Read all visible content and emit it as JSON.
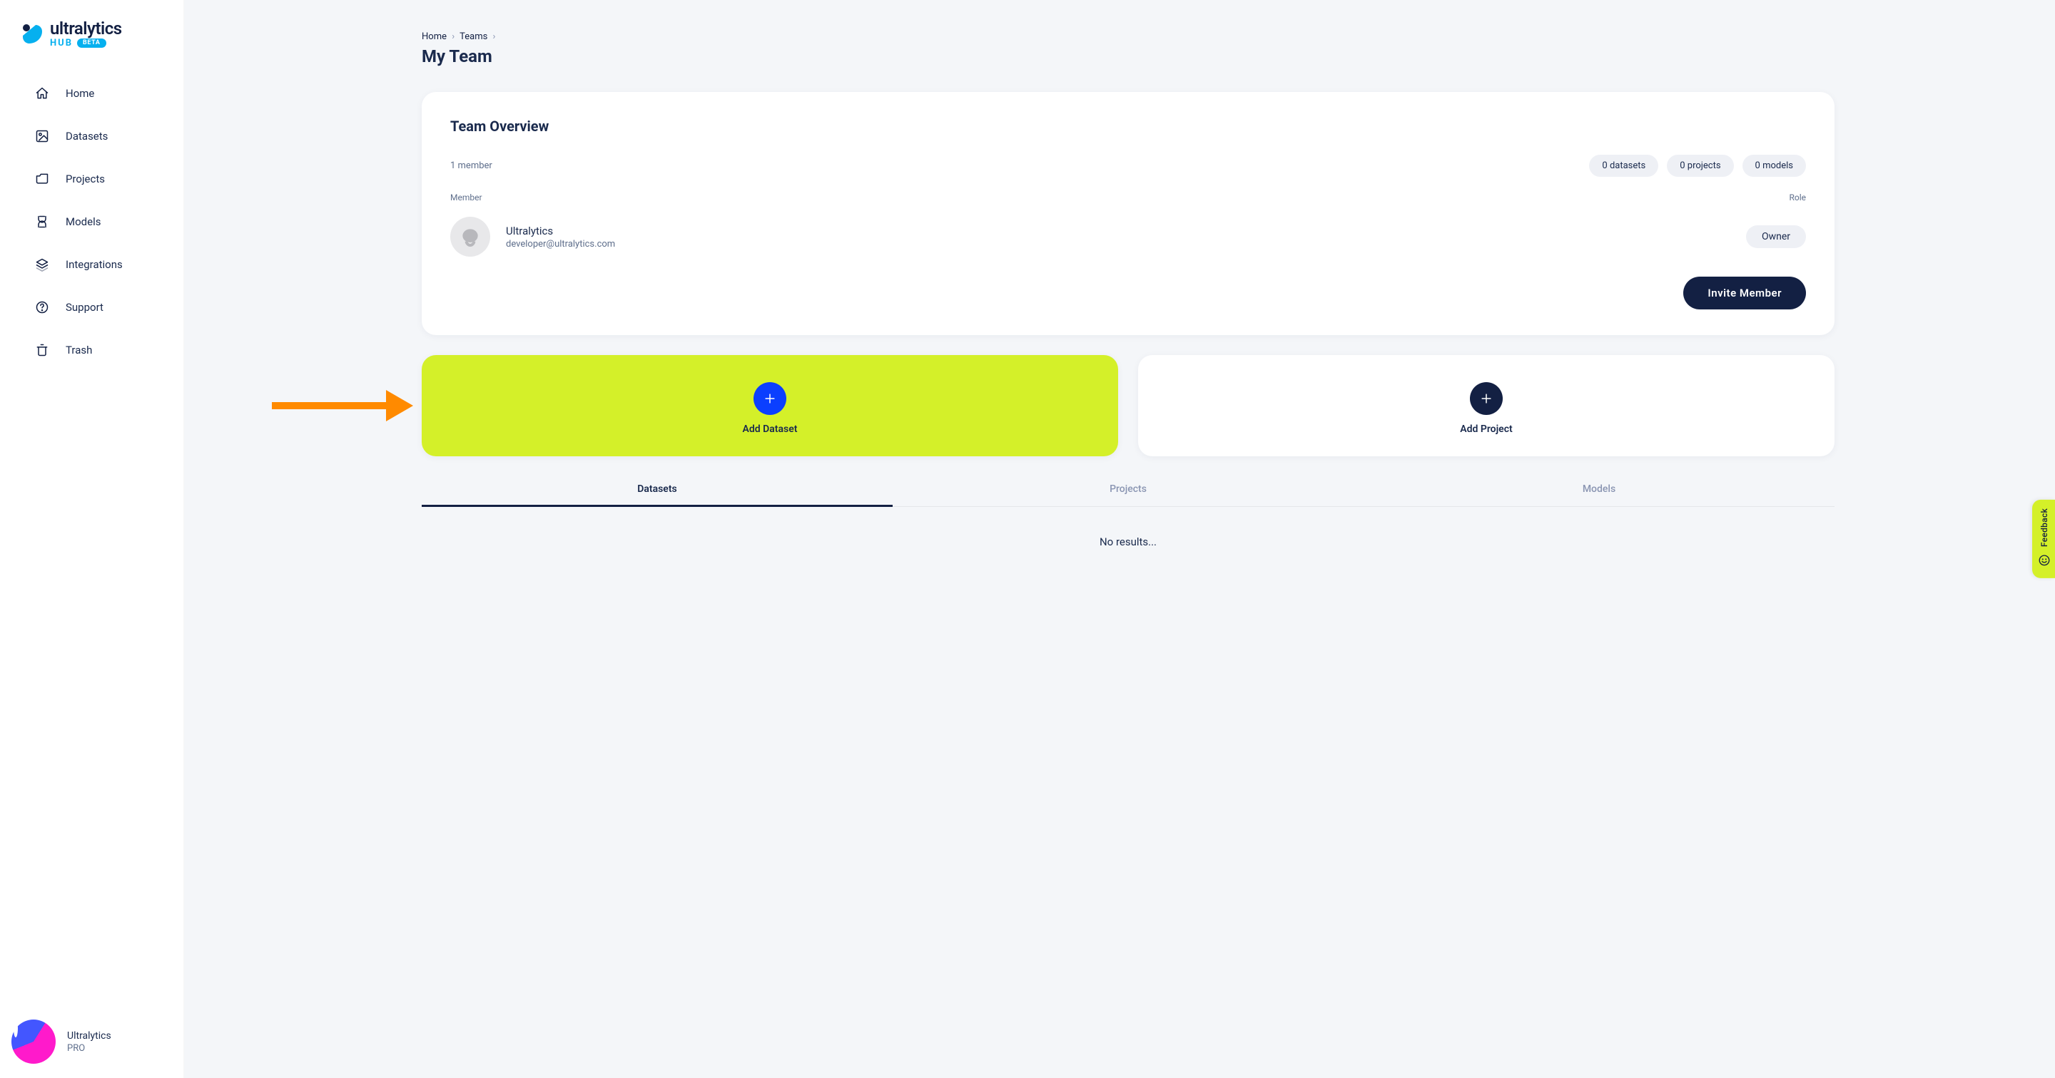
{
  "brand": {
    "name": "ultralytics",
    "hub": "HUB",
    "badge": "BETA"
  },
  "sidebar": {
    "items": [
      {
        "label": "Home"
      },
      {
        "label": "Datasets"
      },
      {
        "label": "Projects"
      },
      {
        "label": "Models"
      },
      {
        "label": "Integrations"
      },
      {
        "label": "Support"
      },
      {
        "label": "Trash"
      }
    ],
    "footer": {
      "name": "Ultralytics",
      "plan": "PRO"
    }
  },
  "breadcrumb": {
    "home": "Home",
    "teams": "Teams"
  },
  "page": {
    "title": "My Team"
  },
  "overview": {
    "title": "Team Overview",
    "member_count": "1 member",
    "stats": {
      "datasets": "0 datasets",
      "projects": "0 projects",
      "models": "0 models"
    },
    "headers": {
      "member": "Member",
      "role": "Role"
    },
    "member": {
      "name": "Ultralytics",
      "email": "developer@ultralytics.com",
      "role": "Owner"
    },
    "invite_label": "Invite Member"
  },
  "actions": {
    "add_dataset": "Add Dataset",
    "add_project": "Add Project"
  },
  "tabs": {
    "datasets": "Datasets",
    "projects": "Projects",
    "models": "Models"
  },
  "results": {
    "none": "No results..."
  },
  "feedback": {
    "label": "Feedback"
  }
}
